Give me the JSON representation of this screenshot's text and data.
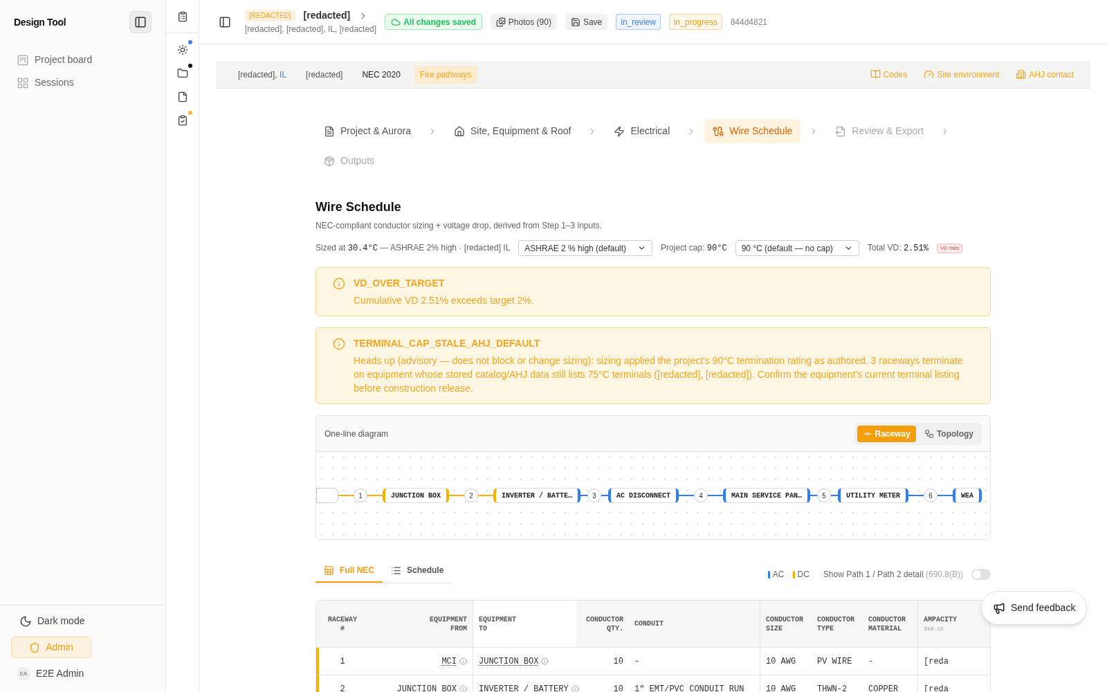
{
  "app": {
    "name": "Design Tool"
  },
  "sidebar": {
    "items": [
      {
        "label": "Project board",
        "kind": "board",
        "selected": false
      },
      {
        "label": "Sessions",
        "kind": "sessions",
        "selected": false
      }
    ],
    "dark_mode": "Dark mode",
    "role": "Admin",
    "user_initials": "EA",
    "user_name": "E2E Admin"
  },
  "rail": [
    {
      "kind": "sun",
      "color": "#3b82f6"
    },
    {
      "kind": "folder",
      "color": "#111111"
    },
    {
      "kind": "file"
    },
    {
      "kind": "checklist",
      "color": "#f5b83d"
    }
  ],
  "header": {
    "tag": "[REDACTED]",
    "title": "[redacted]",
    "address": "[redacted], [redacted], IL, [redacted]",
    "save_status": "All changes saved",
    "photos": "Photos (90)",
    "save": "Save",
    "statuses": [
      {
        "label": "in_review",
        "color": "#3b82f6"
      },
      {
        "label": "in_progress",
        "color": "#f59e0b"
      }
    ],
    "id": "844d4821"
  },
  "info_bar": {
    "chips": [
      {
        "kind": "location",
        "text": "[redacted], ",
        "link": "IL"
      },
      {
        "kind": "plain",
        "text": "[redacted]"
      },
      {
        "kind": "code",
        "text": "NEC 2020"
      },
      {
        "kind": "tag",
        "text": "Fire pathways"
      }
    ],
    "links": [
      {
        "kind": "codes",
        "label": "Codes"
      },
      {
        "kind": "site",
        "label": "Site environment"
      },
      {
        "kind": "ahj",
        "label": "AHJ contact"
      }
    ]
  },
  "steps": [
    {
      "kind": "project",
      "label": "Project & Aurora",
      "selected": false,
      "disabled": false
    },
    {
      "kind": "site",
      "label": "Site, Equipment & Roof",
      "selected": false,
      "disabled": false
    },
    {
      "kind": "electrical",
      "label": "Electrical",
      "selected": false,
      "disabled": false
    },
    {
      "kind": "wire",
      "label": "Wire Schedule",
      "selected": true,
      "disabled": false
    },
    {
      "kind": "review",
      "label": "Review & Export",
      "selected": false,
      "disabled": true
    },
    {
      "kind": "outputs",
      "label": "Outputs",
      "selected": false,
      "disabled": true
    }
  ],
  "page": {
    "title": "Wire Schedule",
    "subtitle": "NEC-compliant conductor sizing + voltage drop, derived from Step 1–3 inputs."
  },
  "conditions": {
    "sized_label": "Sized at",
    "temp": "30.4°C",
    "temp_note": "— ASHRAE 2% high · [redacted] IL",
    "design_select": "ASHRAE 2 % high (default)",
    "cap_label": "Project cap:",
    "cap_value": "90°C",
    "cap_select": "90 °C (default — no cap)",
    "vd_label": "Total VD:",
    "vd_value": "2.51%",
    "vd_badge": "VD fails"
  },
  "alerts": [
    {
      "code": "VD_OVER_TARGET",
      "message": "Cumulative VD 2.51% exceeds target 2%."
    },
    {
      "code": "TERMINAL_CAP_STALE_AHJ_DEFAULT",
      "message": "Heads up (advisory — does not block or change sizing): sizing applied the project's 90°C termination rating as authored. 3 raceways terminate on equipment whose stored catalog/AHJ data still lists 75°C terminals ([redacted], [redacted]). Confirm the equipment's current terminal listing before construction release."
    }
  ],
  "diagram": {
    "title": "One-line diagram",
    "views": [
      {
        "kind": "raceway",
        "label": "Raceway",
        "selected": true
      },
      {
        "kind": "topology",
        "label": "Topology",
        "selected": false
      }
    ],
    "segments": [
      {
        "link": "1",
        "link_ac": false,
        "dashed": false,
        "node": "JUNCTION BOX",
        "in_ac": false,
        "out_ac": false
      },
      {
        "link": "2",
        "link_ac": false,
        "dashed": false,
        "node": "INVERTER / BATTE…",
        "in_ac": false,
        "out_ac": true
      },
      {
        "link": "3",
        "link_ac": true,
        "dashed": true,
        "node": "AC DISCONNECT",
        "in_ac": true,
        "out_ac": true
      },
      {
        "link": "4",
        "link_ac": true,
        "dashed": false,
        "node": "MAIN SERVICE PAN…",
        "in_ac": true,
        "out_ac": true
      },
      {
        "link": "5",
        "link_ac": true,
        "dashed": true,
        "node": "UTILITY METER",
        "in_ac": true,
        "out_ac": true
      },
      {
        "link": "6",
        "link_ac": true,
        "dashed": false,
        "node": "WEA",
        "in_ac": true,
        "out_ac": true
      }
    ]
  },
  "table_tabs": [
    {
      "kind": "grid",
      "label": "Full NEC",
      "selected": true
    },
    {
      "kind": "list",
      "label": "Schedule",
      "selected": false
    }
  ],
  "legend": [
    {
      "label": "AC",
      "color": "#2f7cf6"
    },
    {
      "label": "DC",
      "color": "#f5b000"
    }
  ],
  "path_toggle": {
    "label": "Show Path 1 / Path 2 detail",
    "note": "(690.8(B))",
    "on": false
  },
  "table": {
    "columns": [
      {
        "lines": [
          "RACEWAY",
          "#"
        ]
      },
      {
        "lines": [
          "EQUIPMENT",
          "FROM"
        ]
      },
      {
        "lines": [
          "EQUIPMENT",
          "TO"
        ]
      },
      {
        "lines": [
          "CONDUCTOR",
          "QTY."
        ]
      },
      {
        "lines": [
          "CONDUIT"
        ]
      },
      {
        "lines": [
          "CONDUCTOR",
          "SIZE"
        ]
      },
      {
        "lines": [
          "CONDUCTOR",
          "TYPE"
        ]
      },
      {
        "lines": [
          "CONDUCTOR",
          "MATERIAL"
        ]
      },
      {
        "lines": [
          "AMPACITY"
        ],
        "note": "310.15"
      }
    ],
    "rows": [
      {
        "kind": "dc",
        "cells": [
          "1",
          "MCI",
          "JUNCTION BOX",
          "10",
          "-",
          "10 AWG",
          "PV WIRE",
          "-",
          "[reda"
        ]
      },
      {
        "kind": "dc",
        "cells": [
          "2",
          "JUNCTION BOX",
          "INVERTER / BATTERY",
          "10",
          "1\" EMT/PVC CONDUIT RUN",
          "10 AWG",
          "THWN-2",
          "COPPER",
          "[reda"
        ]
      }
    ]
  },
  "feedback": "Send feedback"
}
